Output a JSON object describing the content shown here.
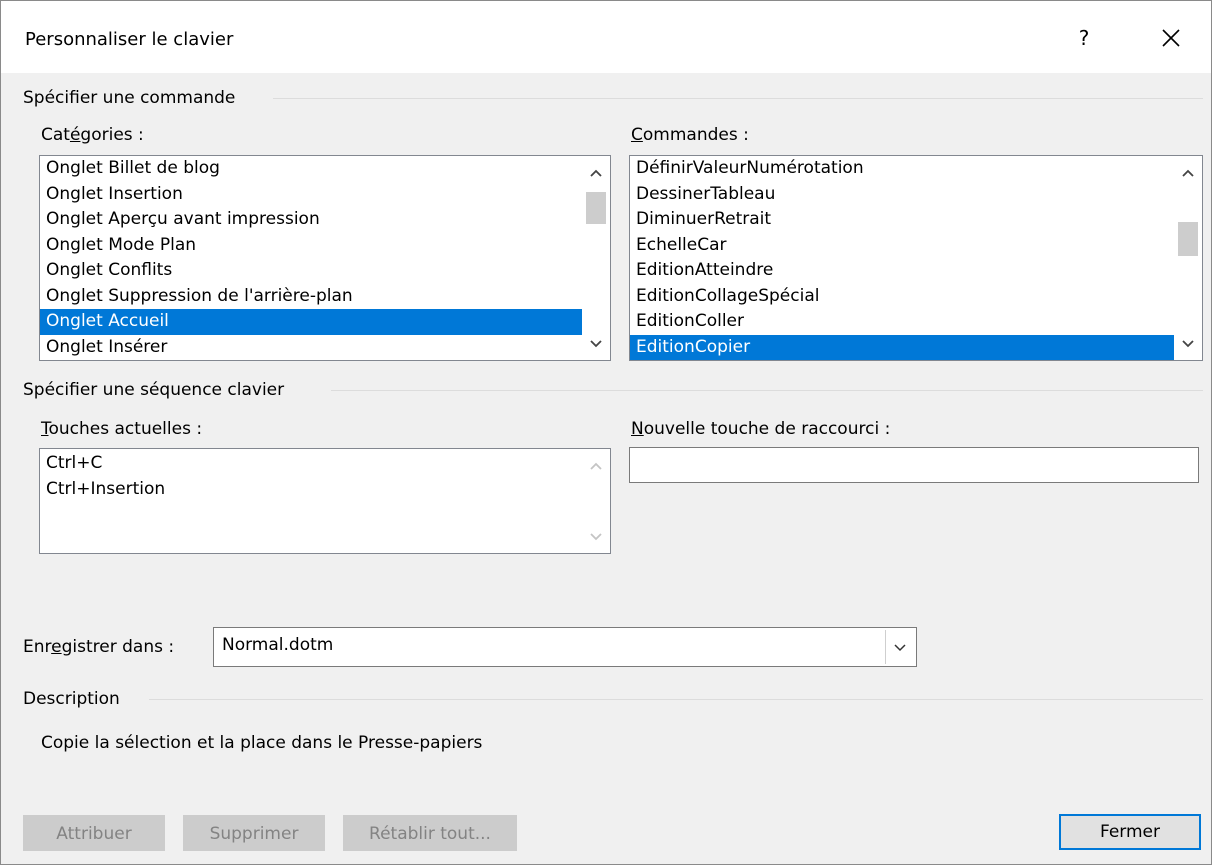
{
  "dialog": {
    "title": "Personnaliser le clavier",
    "help_label": "?"
  },
  "command_group": {
    "title": "Spécifier une commande",
    "categories_label": {
      "pre": "Cat",
      "acc": "é",
      "post": "gories :"
    },
    "commands_label": {
      "pre": "",
      "acc": "C",
      "post": "ommandes :"
    },
    "categories": [
      "Onglet Billet de blog",
      "Onglet Insertion",
      "Onglet Aperçu avant impression",
      "Onglet Mode Plan",
      "Onglet Conflits",
      "Onglet Suppression de l'arrière-plan",
      "Onglet Accueil",
      "Onglet Insérer"
    ],
    "categories_selected_index": 6,
    "commands": [
      "DéfinirValeurNumérotation",
      "DessinerTableau",
      "DiminuerRetrait",
      "EchelleCar",
      "EditionAtteindre",
      "EditionCollageSpécial",
      "EditionColler",
      "EditionCopier"
    ],
    "commands_selected_index": 7
  },
  "keyboard_group": {
    "title": "Spécifier une séquence clavier",
    "current_keys_label": {
      "pre": "",
      "acc": "T",
      "post": "ouches actuelles :"
    },
    "current_keys": [
      "Ctrl+C",
      "Ctrl+Insertion"
    ],
    "new_shortcut_label": {
      "pre": "",
      "acc": "N",
      "post": "ouvelle touche de raccourci :"
    },
    "new_shortcut_value": ""
  },
  "save_in": {
    "label": {
      "pre": "Enr",
      "acc": "e",
      "post": "gistrer dans :"
    },
    "value": "Normal.dotm"
  },
  "description": {
    "title": "Description",
    "text": "Copie la sélection et la place dans le Presse-papiers"
  },
  "buttons": {
    "assign": "Attribuer",
    "remove": "Supprimer",
    "reset_all": "Rétablir tout...",
    "close": "Fermer"
  },
  "colors": {
    "selection": "#0078d7",
    "dialog_bg": "#f0f0f0",
    "disabled_button": "#cccccc"
  }
}
